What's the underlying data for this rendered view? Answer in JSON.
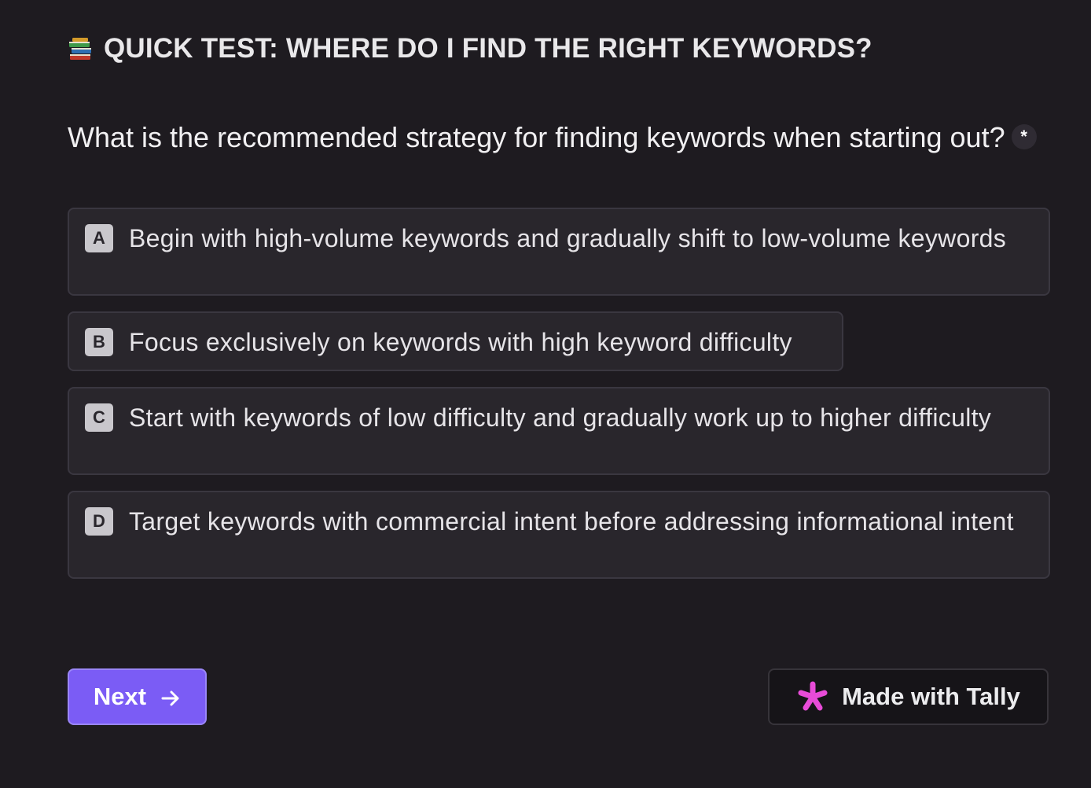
{
  "form": {
    "title_icon": "books-icon",
    "title": "QUICK TEST: WHERE DO I FIND THE RIGHT KEYWORDS?"
  },
  "question": {
    "text": "What is the recommended strategy for finding keywords when starting out?",
    "required_marker": "*"
  },
  "options": [
    {
      "key": "A",
      "label": "Begin with high-volume keywords and gradually shift to low-volume keywords"
    },
    {
      "key": "B",
      "label": "Focus exclusively on keywords with high keyword difficulty"
    },
    {
      "key": "C",
      "label": "Start with keywords of low difficulty and gradually work up to higher difficulty"
    },
    {
      "key": "D",
      "label": "Target keywords with commercial intent before addressing informational intent"
    }
  ],
  "next_button": {
    "label": "Next",
    "icon": "arrow-right-icon"
  },
  "badge": {
    "label": "Made with Tally",
    "icon": "tally-asterisk-icon"
  },
  "colors": {
    "background": "#1e1b20",
    "accent": "#7b5cf5",
    "tally_pink": "#e84bd8"
  }
}
